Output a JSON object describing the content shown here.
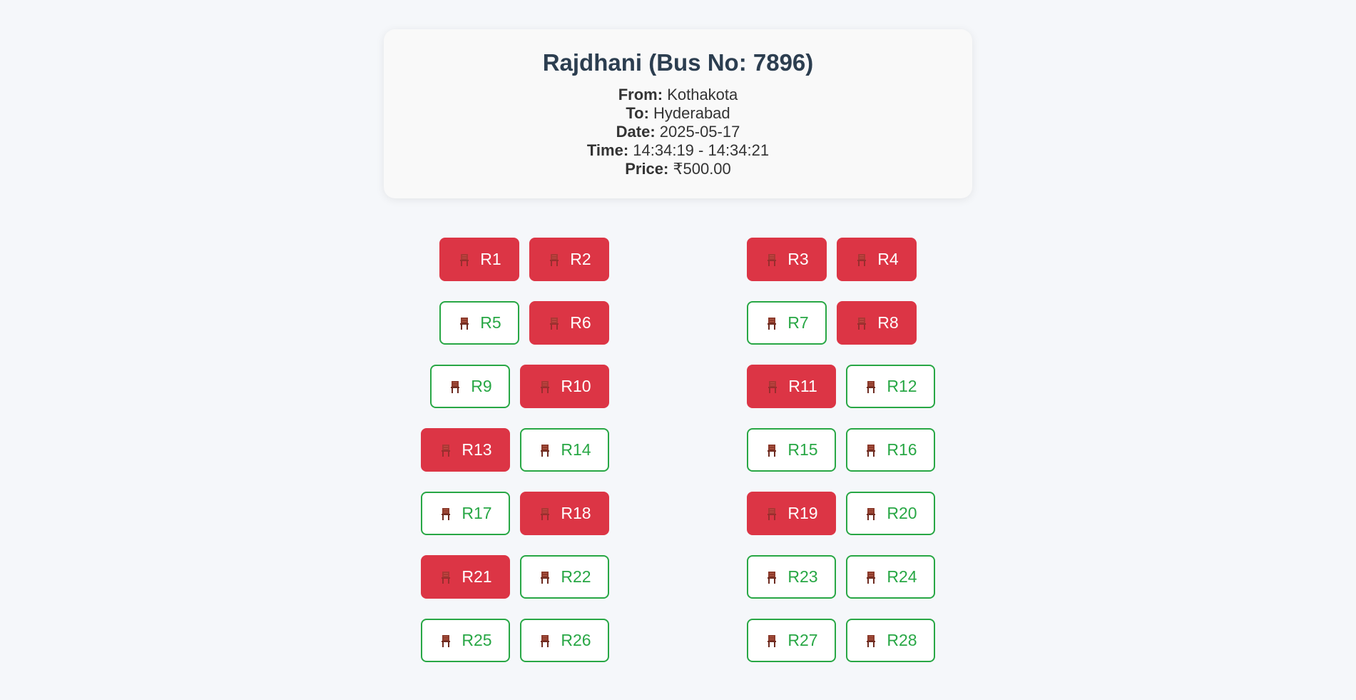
{
  "bus": {
    "title": "Rajdhani (Bus No: 7896)",
    "from_label": "From:",
    "from": "Kothakota",
    "to_label": "To:",
    "to": "Hyderabad",
    "date_label": "Date:",
    "date": "2025-05-17",
    "time_label": "Time:",
    "time": "14:34:19 - 14:34:21",
    "price_label": "Price:",
    "price": "₹500.00"
  },
  "seats": [
    {
      "label": "R1",
      "status": "booked"
    },
    {
      "label": "R2",
      "status": "booked"
    },
    {
      "label": "R3",
      "status": "booked"
    },
    {
      "label": "R4",
      "status": "booked"
    },
    {
      "label": "R5",
      "status": "available"
    },
    {
      "label": "R6",
      "status": "booked"
    },
    {
      "label": "R7",
      "status": "available"
    },
    {
      "label": "R8",
      "status": "booked"
    },
    {
      "label": "R9",
      "status": "available"
    },
    {
      "label": "R10",
      "status": "booked"
    },
    {
      "label": "R11",
      "status": "booked"
    },
    {
      "label": "R12",
      "status": "available"
    },
    {
      "label": "R13",
      "status": "booked"
    },
    {
      "label": "R14",
      "status": "available"
    },
    {
      "label": "R15",
      "status": "available"
    },
    {
      "label": "R16",
      "status": "available"
    },
    {
      "label": "R17",
      "status": "available"
    },
    {
      "label": "R18",
      "status": "booked"
    },
    {
      "label": "R19",
      "status": "booked"
    },
    {
      "label": "R20",
      "status": "available"
    },
    {
      "label": "R21",
      "status": "booked"
    },
    {
      "label": "R22",
      "status": "available"
    },
    {
      "label": "R23",
      "status": "available"
    },
    {
      "label": "R24",
      "status": "available"
    },
    {
      "label": "R25",
      "status": "available"
    },
    {
      "label": "R26",
      "status": "available"
    },
    {
      "label": "R27",
      "status": "available"
    },
    {
      "label": "R28",
      "status": "available"
    }
  ],
  "seat_icon": "chair-icon",
  "colors": {
    "booked": "#dc3545",
    "available": "#28a745",
    "title": "#2c3e50"
  }
}
